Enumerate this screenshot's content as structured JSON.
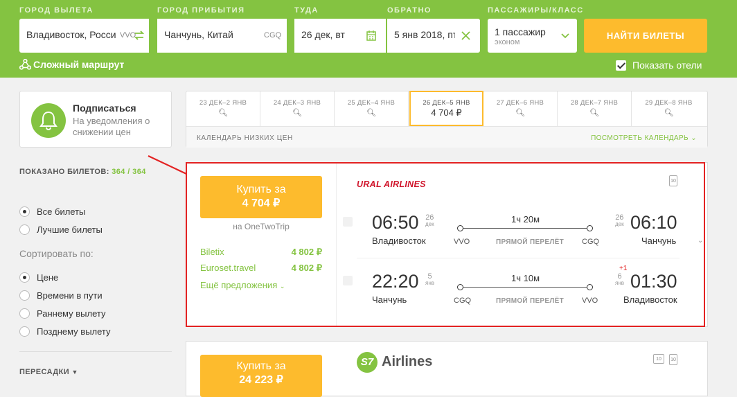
{
  "search": {
    "from_label": "ГОРОД ВЫЛЕТА",
    "from_value": "Владивосток, Россия",
    "from_code": "VVO",
    "to_label": "ГОРОД ПРИБЫТИЯ",
    "to_value": "Чанчунь, Китай",
    "to_code": "CGQ",
    "depart_label": "ТУДА",
    "depart_value": "26 дек, вт",
    "return_label": "ОБРАТНО",
    "return_value": "5 янв 2018, пт",
    "pax_label": "ПАССАЖИРЫ/КЛАСС",
    "pax_value": "1 пассажир",
    "pax_class": "эконом",
    "find_button": "НАЙТИ БИЛЕТЫ",
    "complex_route": "Сложный маршрут",
    "show_hotels": "Показать отели"
  },
  "subscribe": {
    "title": "Подписаться",
    "desc": "На уведомления о снижении цен"
  },
  "calendar": {
    "days": [
      {
        "label": "23 ДЕК–2 ЯНВ"
      },
      {
        "label": "24 ДЕК–3 ЯНВ"
      },
      {
        "label": "25 ДЕК–4 ЯНВ"
      },
      {
        "label": "26 ДЕК–5 ЯНВ",
        "price": "4 704 ₽"
      },
      {
        "label": "27 ДЕК–6 ЯНВ"
      },
      {
        "label": "28 ДЕК–7 ЯНВ"
      },
      {
        "label": "29 ДЕК–8 ЯНВ"
      }
    ],
    "low_prices": "КАЛЕНДАРЬ НИЗКИХ ЦЕН",
    "view_calendar": "ПОСМОТРЕТЬ КАЛЕНДАРЬ"
  },
  "filters": {
    "shown_label": "ПОКАЗАНО БИЛЕТОВ:",
    "shown_count": "364 / 364",
    "all_tickets": "Все билеты",
    "best_tickets": "Лучшие билеты",
    "sort_by": "Сортировать по:",
    "sort_price": "Цене",
    "sort_time": "Времени в пути",
    "sort_early": "Раннему вылету",
    "sort_late": "Позднему вылету",
    "transfers": "ПЕРЕСАДКИ"
  },
  "ticket1": {
    "buy_label": "Купить за",
    "buy_price": "4 704 ₽",
    "agency": "на OneTwoTrip",
    "offers": [
      {
        "name": "Biletix",
        "price": "4 802 ₽"
      },
      {
        "name": "Euroset.travel",
        "price": "4 802 ₽"
      }
    ],
    "more_offers": "Ещё предложения",
    "airline": "URAL AIRLINES",
    "outbound": {
      "dep_time": "06:50",
      "dep_day": "26",
      "dep_month": "дек",
      "dep_city": "Владивосток",
      "dep_code": "VVO",
      "duration": "1ч 20м",
      "direct": "ПРЯМОЙ ПЕРЕЛЁТ",
      "arr_code": "CGQ",
      "arr_day": "26",
      "arr_month": "дек",
      "arr_time": "06:10",
      "arr_city": "Чанчунь"
    },
    "inbound": {
      "dep_time": "22:20",
      "dep_day": "5",
      "dep_month": "янв",
      "dep_city": "Чанчунь",
      "dep_code": "CGQ",
      "duration": "1ч 10м",
      "direct": "ПРЯМОЙ ПЕРЕЛЁТ",
      "arr_code": "VVO",
      "arr_day": "6",
      "arr_month": "янв",
      "arr_plus": "+1",
      "arr_time": "01:30",
      "arr_city": "Владивосток"
    },
    "luggage": "10"
  },
  "ticket2": {
    "buy_label": "Купить за",
    "buy_price": "24 223 ₽",
    "airline_logo": "S7",
    "airline_name": "Airlines",
    "luggage": "10"
  },
  "colors": {
    "green": "#84c341",
    "orange": "#fdbb2d",
    "red": "#e32222"
  }
}
